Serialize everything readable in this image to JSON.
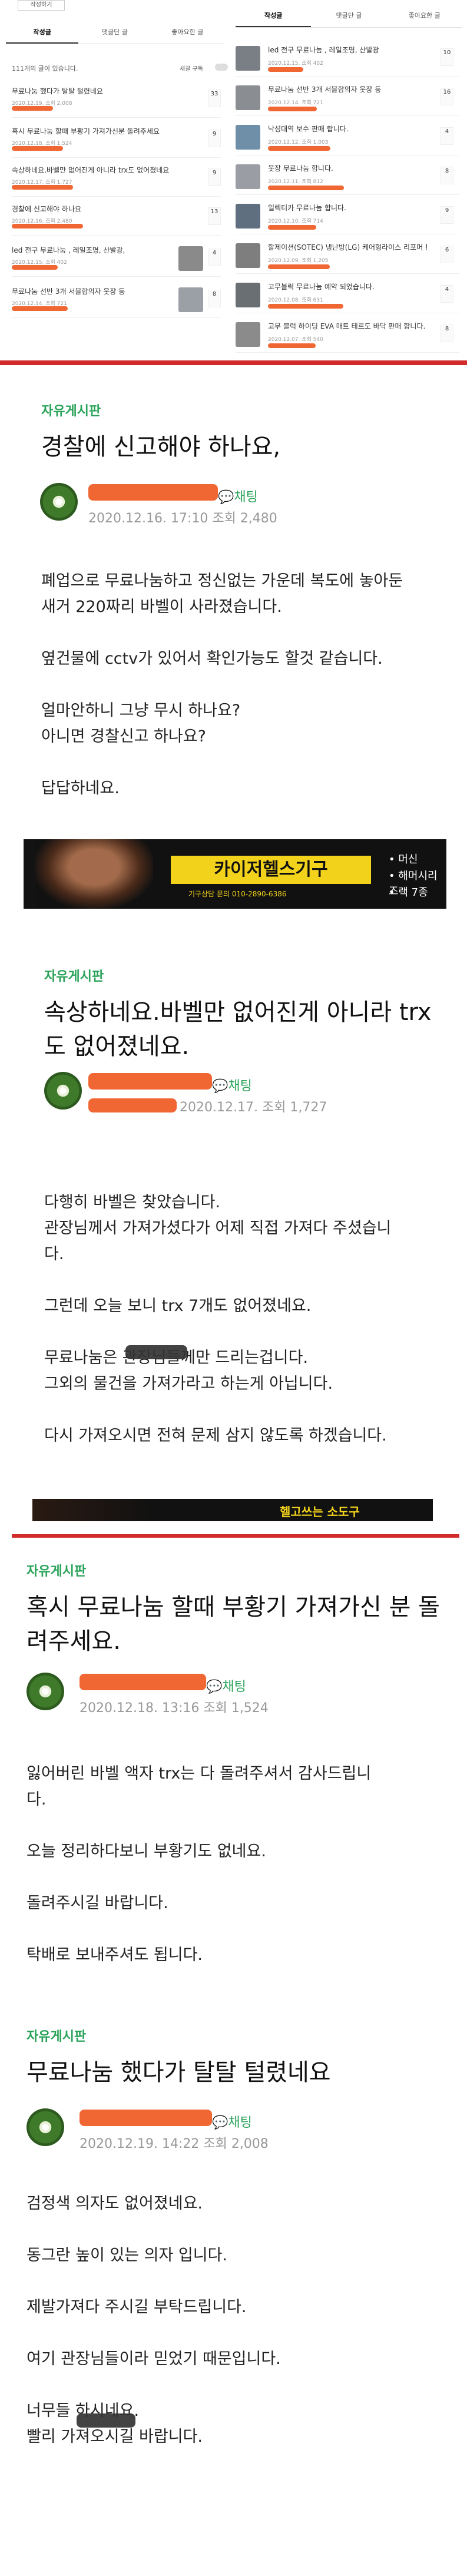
{
  "top_nav": {
    "left_btn": "작성하기",
    "right_btn": ""
  },
  "tabs_left": [
    "작성글",
    "댓글단 글",
    "좋아요한 글"
  ],
  "tabs_right": [
    "작성글",
    "댓글단 글",
    "좋아요한 글"
  ],
  "post_count_label": "111개의 글이 있습니다.",
  "delete_label": "새글 구독",
  "left_list": [
    {
      "title": "무료나눔 했다가 탈탈 털렸네요",
      "meta": "2020.12.19. 조회 2,008",
      "count": "33"
    },
    {
      "title": "혹시 무료나눔 할때 부황기 가져가신분 돌려주세요",
      "meta": "2020.12.18. 조회 1,524",
      "count": "9"
    },
    {
      "title": "속상하네요.바벨만 없어진게 아니라 trx도 없어졌네요",
      "meta": "2020.12.17. 조회 1,727",
      "count": "9"
    },
    {
      "title": "경찰에 신고해야 하나요",
      "meta": "2020.12.16. 조회 2,480",
      "count": "13"
    },
    {
      "title": "led 전구 무료나눔 , 레일조명, 산발광,",
      "meta": "2020.12.15. 조회 402",
      "count": "4"
    },
    {
      "title": "무료나눔 선반 3개 서블합의자 웃장 등",
      "meta": "2020.12.14. 조회 721",
      "count": "8"
    }
  ],
  "right_list": [
    {
      "title": "led 전구 무료나눔 , 레일조명, 산발광",
      "meta": "2020.12.15. 조회 402",
      "count": "10"
    },
    {
      "title": "무료나눔 선반 3개 서블합의자 웃장 등",
      "meta": "2020.12.14. 조회 721",
      "count": "16"
    },
    {
      "title": "낙성대역 보수 판매 합니다.",
      "meta": "2020.12.12. 조회 1,003",
      "count": "4"
    },
    {
      "title": "웃장 무료나눔 합니다.",
      "meta": "2020.12.11. 조회 812",
      "count": "8"
    },
    {
      "title": "일렉티카 무료나눔 합니다.",
      "meta": "2020.12.10. 조회 714",
      "count": "9"
    },
    {
      "title": "할제이션(SOTEC) 냉난방(LG) 케어형라이스 리포머 판매 합니다.",
      "meta": "2020.12.09. 조회 1,205",
      "count": "6"
    },
    {
      "title": "고무블럭 무료나눔 예약 되었습니다.",
      "meta": "2020.12.08. 조회 631",
      "count": "4"
    },
    {
      "title": "고무 블럭 하이딩 EVA 매트 테르도 바닥 판매 합니다.",
      "meta": "2020.12.07. 조회 540",
      "count": "8"
    }
  ],
  "post1": {
    "board": "자유게시판",
    "title": "경찰에 신고해야 하나요,",
    "chat": "채팅",
    "meta": "2020.12.16. 17:10 조회 2,480",
    "body": [
      "폐업으로 무료나눔하고 정신없는 가운데 복도에 놓아둔",
      "새거 220짜리 바벨이 사라졌습니다.",
      "",
      "옆건물에 cctv가 있어서 확인가능도 할것 같습니다.",
      "",
      "얼마안하니 그냥 무시 하나요?",
      "아니면 경찰신고 하나요?",
      "",
      "답답하네요."
    ]
  },
  "banner1": {
    "title": "카이저헬스기구",
    "sub": "기구상담 문의 010-2890-6386",
    "items": [
      "• 머신",
      "• 해머시리즈",
      "• 랙 7종"
    ]
  },
  "post2": {
    "board": "자유게시판",
    "title": "속상하네요.바벨만 없어진게 아니라 trx도 없어졌네요.",
    "chat": "채팅",
    "meta": "2020.12.17. 조회 1,727",
    "body": [
      "다행히 바벨은 찾았습니다.",
      "관장님께서 가져가셨다가 어제 직접 가져다 주셨습니",
      "다.",
      "",
      "그런데 오늘 보니 trx 7개도 없어졌네요.",
      "",
      "무료나눔은 관장님들께만 드리는겁니다.",
      "그외의 물건을 가져가라고 하는게 아닙니다.",
      "",
      "다시 가져오시면 전혀 문제 삼지 않도록 하겠습니다."
    ]
  },
  "banner2": {
    "title": "헬고쓰는 소도구"
  },
  "post3": {
    "board": "자유게시판",
    "title": "혹시 무료나눔 할때 부황기 가져가신 분 돌려주세요.",
    "chat": "채팅",
    "meta": "2020.12.18. 13:16 조회 1,524",
    "body": [
      "잃어버린 바벨 액자 trx는 다 돌려주셔서  감사드립니",
      "다.",
      "",
      "오늘 정리하다보니 부황기도  없네요.",
      "",
      " 돌려주시길 바랍니다.",
      "",
      "탁배로 보내주셔도 됩니다."
    ]
  },
  "post4": {
    "board": "자유게시판",
    "title": "무료나눔 했다가 탈탈 털렸네요",
    "chat": "채팅",
    "meta": "2020.12.19. 14:22 조회 2,008",
    "body": [
      "검정색 의자도 없어졌네요.",
      "",
      "동그란 높이 있는 의자 입니다.",
      "",
      "제발가져다 주시길 부탁드립니다.",
      "",
      "여기 관장님들이라 믿었기 때문입니다.",
      "",
      "너무들 하시네요.",
      "빨리 가져오시길 바랍니다."
    ]
  },
  "colors": {
    "accent_green": "#2aa35a",
    "redact": "#f05a22",
    "divider": "#d12b2b"
  }
}
